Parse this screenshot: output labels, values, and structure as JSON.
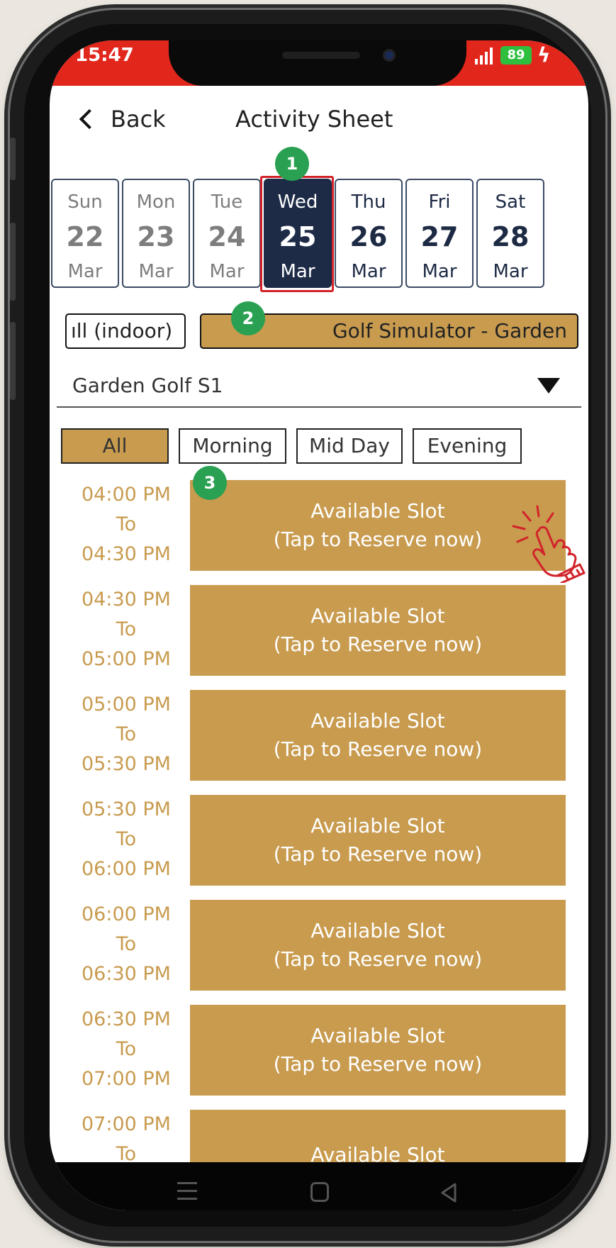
{
  "status_bar": {
    "time": "15:47",
    "battery": "89"
  },
  "header": {
    "back_label": "Back",
    "title": "Activity Sheet"
  },
  "dates": [
    {
      "dow": "Sun",
      "day": "22",
      "month": "Mar"
    },
    {
      "dow": "Mon",
      "day": "23",
      "month": "Mar"
    },
    {
      "dow": "Tue",
      "day": "24",
      "month": "Mar"
    },
    {
      "dow": "Wed",
      "day": "25",
      "month": "Mar"
    },
    {
      "dow": "Thu",
      "day": "26",
      "month": "Mar"
    },
    {
      "dow": "Fri",
      "day": "27",
      "month": "Mar"
    },
    {
      "dow": "Sat",
      "day": "28",
      "month": "Mar"
    }
  ],
  "selected_date_index": 3,
  "facilities": {
    "left_chip": "ıll (indoor)",
    "selected_chip": "Golf Simulator - Garden"
  },
  "dropdown": {
    "value": "Garden Golf S1"
  },
  "filters": [
    "All",
    "Morning",
    "Mid Day",
    "Evening"
  ],
  "badges": [
    "1",
    "2",
    "3"
  ],
  "slots": [
    {
      "from": "04:00 PM",
      "to_word": "To",
      "to": "04:30 PM",
      "line1": "Available Slot",
      "line2": "(Tap to Reserve now)"
    },
    {
      "from": "04:30 PM",
      "to_word": "To",
      "to": "05:00 PM",
      "line1": "Available Slot",
      "line2": "(Tap to Reserve now)"
    },
    {
      "from": "05:00 PM",
      "to_word": "To",
      "to": "05:30 PM",
      "line1": "Available Slot",
      "line2": "(Tap to Reserve now)"
    },
    {
      "from": "05:30 PM",
      "to_word": "To",
      "to": "06:00 PM",
      "line1": "Available Slot",
      "line2": "(Tap to Reserve now)"
    },
    {
      "from": "06:00 PM",
      "to_word": "To",
      "to": "06:30 PM",
      "line1": "Available Slot",
      "line2": "(Tap to Reserve now)"
    },
    {
      "from": "06:30 PM",
      "to_word": "To",
      "to": "07:00 PM",
      "line1": "Available Slot",
      "line2": "(Tap to Reserve now)"
    },
    {
      "from": "07:00 PM",
      "to_word": "To",
      "to": "",
      "line1": "Available Slot",
      "line2": ""
    }
  ],
  "icons": {
    "back": "chevron-left-icon",
    "dropdown": "triangle-down-icon",
    "tap": "tap-hand-icon"
  },
  "colors": {
    "status_red": "#e1261c",
    "gold": "#c89b4f",
    "navy": "#1d2b47",
    "badge_green": "#2aa152",
    "highlight_red": "#d2232a"
  }
}
